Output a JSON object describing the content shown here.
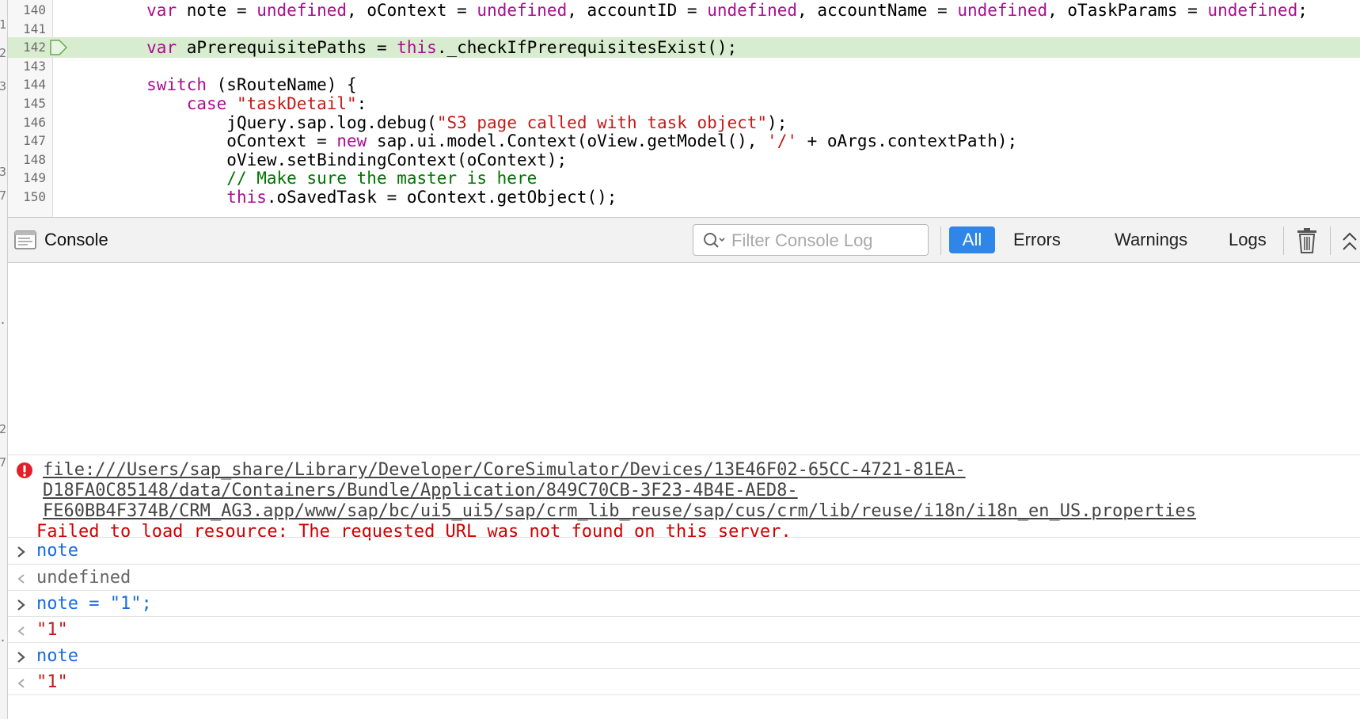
{
  "left_sliver": {
    "chars": [
      "1",
      "2",
      "3",
      "3",
      "7",
      ".",
      "2",
      "7",
      "·"
    ]
  },
  "editor": {
    "lines": [
      {
        "number": "140",
        "indent": "        ",
        "segments": [
          {
            "t": "var",
            "c": "kw"
          },
          {
            "t": " note = ",
            "c": ""
          },
          {
            "t": "undefined",
            "c": "kw"
          },
          {
            "t": ", oContext = ",
            "c": ""
          },
          {
            "t": "undefined",
            "c": "kw"
          },
          {
            "t": ", accountID = ",
            "c": ""
          },
          {
            "t": "undefined",
            "c": "kw"
          },
          {
            "t": ", accountName = ",
            "c": ""
          },
          {
            "t": "undefined",
            "c": "kw"
          },
          {
            "t": ", oTaskParams = ",
            "c": ""
          },
          {
            "t": "undefined",
            "c": "kw"
          },
          {
            "t": ";",
            "c": ""
          }
        ]
      },
      {
        "number": "141",
        "indent": "",
        "segments": []
      },
      {
        "number": "142",
        "indent": "        ",
        "highlight": true,
        "segments": [
          {
            "t": "var",
            "c": "kw"
          },
          {
            "t": " aPrerequisitePaths = ",
            "c": ""
          },
          {
            "t": "this",
            "c": "kw"
          },
          {
            "t": "._checkIfPrerequisitesExist();",
            "c": ""
          }
        ]
      },
      {
        "number": "143",
        "indent": "",
        "segments": []
      },
      {
        "number": "144",
        "indent": "        ",
        "segments": [
          {
            "t": "switch",
            "c": "kw"
          },
          {
            "t": " (sRouteName) {",
            "c": ""
          }
        ]
      },
      {
        "number": "145",
        "indent": "            ",
        "segments": [
          {
            "t": "case",
            "c": "kw"
          },
          {
            "t": " ",
            "c": ""
          },
          {
            "t": "\"taskDetail\"",
            "c": "str"
          },
          {
            "t": ":",
            "c": ""
          }
        ]
      },
      {
        "number": "146",
        "indent": "                ",
        "segments": [
          {
            "t": "jQuery.sap.log.debug(",
            "c": ""
          },
          {
            "t": "\"S3 page called with task object\"",
            "c": "str"
          },
          {
            "t": ");",
            "c": ""
          }
        ]
      },
      {
        "number": "147",
        "indent": "                ",
        "segments": [
          {
            "t": "oContext = ",
            "c": ""
          },
          {
            "t": "new",
            "c": "kw"
          },
          {
            "t": " sap.ui.model.Context(oView.getModel(), ",
            "c": ""
          },
          {
            "t": "'/'",
            "c": "str"
          },
          {
            "t": " + oArgs.contextPath);",
            "c": ""
          }
        ]
      },
      {
        "number": "148",
        "indent": "                ",
        "segments": [
          {
            "t": "oView.setBindingContext(oContext);",
            "c": ""
          }
        ]
      },
      {
        "number": "149",
        "indent": "                ",
        "segments": [
          {
            "t": "// Make sure the master is here",
            "c": "cmt"
          }
        ]
      },
      {
        "number": "150",
        "indent": "                ",
        "segments": [
          {
            "t": "this",
            "c": "kw"
          },
          {
            "t": ".oSavedTask = oContext.getObject();",
            "c": ""
          }
        ]
      }
    ]
  },
  "toolbar": {
    "title": "Console",
    "filter_placeholder": "Filter Console Log",
    "filters": [
      {
        "label": "All",
        "active": true
      },
      {
        "label": "Errors",
        "active": false
      },
      {
        "label": "Warnings",
        "active": false
      },
      {
        "label": "Logs",
        "active": false
      }
    ],
    "trash_icon": "trash-icon",
    "collapse_icon": "chevron-up-icon"
  },
  "console": {
    "error": {
      "url_lines": [
        "file:///Users/sap_share/Library/Developer/CoreSimulator/Devices/13E46F02-65CC-4721-81EA-",
        "D18FA0C85148/data/Containers/Bundle/Application/849C70CB-3F23-4B4E-AED8-",
        "FE60BB4F374B/CRM_AG3.app/www/sap/bc/ui5_ui5/sap/crm_lib_reuse/sap/cus/crm/lib/reuse/i18n/i18n_en_US.properties"
      ],
      "message": "Failed to load resource: The requested URL was not found on this server."
    },
    "entries": [
      {
        "kind": "input",
        "text": "note"
      },
      {
        "kind": "output",
        "text": "undefined"
      },
      {
        "kind": "input",
        "text": "note = \"1\";"
      },
      {
        "kind": "output-string",
        "text": "\"1\""
      },
      {
        "kind": "input",
        "text": "note"
      },
      {
        "kind": "output-string",
        "text": "\"1\""
      }
    ]
  },
  "colors": {
    "keyword": "#aa0d91",
    "string": "#c41a16",
    "comment": "#007400",
    "highlight": "#d8ecd0",
    "error": "#d00000",
    "accent": "#2f86e8",
    "input_text": "#1a6be0"
  }
}
